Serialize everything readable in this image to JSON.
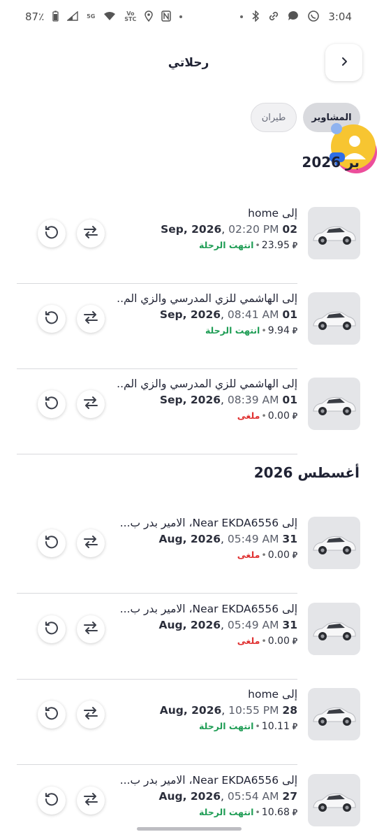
{
  "status_bar": {
    "battery": "87٪",
    "network_5g": "5G",
    "volte": "Vo",
    "carrier": "STC",
    "time": "3:04",
    "icons": [
      "battery-icon",
      "signal-icon",
      "wifi-icon",
      "location-icon",
      "nfc-icon",
      "dot-icon",
      "dot-icon",
      "bluetooth-icon",
      "link-icon",
      "chat-icon",
      "whatsapp-icon"
    ]
  },
  "header": {
    "title": "رحلاتي",
    "back_icon": "chevron-right-icon"
  },
  "filters": {
    "active": "المشاوير",
    "inactive": "طيران"
  },
  "currency_symbol": "⃁",
  "sections": [
    {
      "title": "بر 2026",
      "trips": [
        {
          "prefix": "إلى",
          "destination": "home",
          "day": "02",
          "month": "Sep, 2026",
          "time": "02:20 PM",
          "price": "23.95",
          "status": "انتهت الرحلة",
          "status_type": "done"
        },
        {
          "prefix": "إلى",
          "destination": "الهاشمي للزي المدرسي والزي الم...",
          "day": "01",
          "month": "Sep, 2026",
          "time": "08:41 AM",
          "price": "9.94",
          "status": "انتهت الرحلة",
          "status_type": "done"
        },
        {
          "prefix": "إلى",
          "destination": "الهاشمي للزي المدرسي والزي الم...",
          "day": "01",
          "month": "Sep, 2026",
          "time": "08:39 AM",
          "price": "0.00",
          "status": "ملغى",
          "status_type": "cancel"
        }
      ]
    },
    {
      "title": "أغسطس 2026",
      "trips": [
        {
          "prefix": "إلى",
          "destination": "Near EKDA6556، الامير بدر ب...",
          "day": "31",
          "month": "Aug, 2026",
          "time": "05:49 AM",
          "price": "0.00",
          "status": "ملغى",
          "status_type": "cancel"
        },
        {
          "prefix": "إلى",
          "destination": "Near EKDA6556، الامير بدر ب...",
          "day": "31",
          "month": "Aug, 2026",
          "time": "05:49 AM",
          "price": "0.00",
          "status": "ملغى",
          "status_type": "cancel"
        },
        {
          "prefix": "إلى",
          "destination": "home",
          "day": "28",
          "month": "Aug, 2026",
          "time": "10:55 PM",
          "price": "10.11",
          "status": "انتهت الرحلة",
          "status_type": "done"
        },
        {
          "prefix": "إلى",
          "destination": "Near EKDA6556، الامير بدر ب...",
          "day": "27",
          "month": "Aug, 2026",
          "time": "05:54 AM",
          "price": "10.68",
          "status": "انتهت الرحلة",
          "status_type": "done"
        }
      ]
    }
  ],
  "colors": {
    "done": "#1f9d55",
    "cancel": "#e03131",
    "text": "#1f2233"
  }
}
